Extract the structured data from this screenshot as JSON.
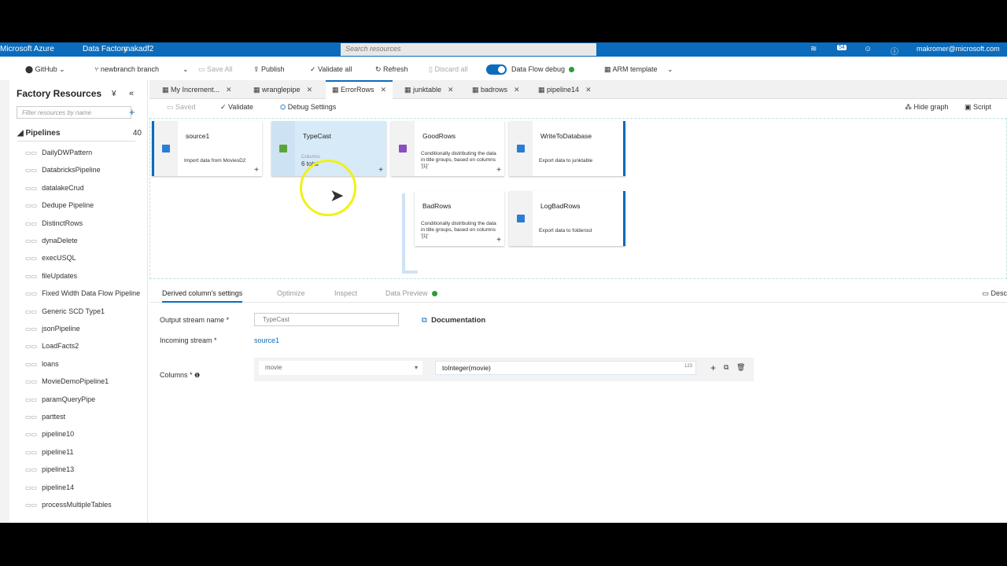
{
  "header": {
    "brand": "Microsoft Azure",
    "service": "Data Factory",
    "factory": "makadf2",
    "search_placeholder": "Search resources",
    "notifications": "54",
    "user": "makromer@microsoft.com"
  },
  "toolbar": {
    "github": "GitHub",
    "branch": "newbranch branch",
    "save_all": "Save All",
    "publish": "Publish",
    "validate_all": "Validate all",
    "refresh": "Refresh",
    "discard_all": "Discard all",
    "debug": "Data Flow debug",
    "arm": "ARM template"
  },
  "sidebar": {
    "title": "Factory Resources",
    "filter_placeholder": "Filter resources by name",
    "section": "Pipelines",
    "count": "40",
    "items": [
      "DailyDWPattern",
      "DatabricksPipeline",
      "datalakeCrud",
      "Dedupe Pipeline",
      "DistinctRows",
      "dynaDelete",
      "execUSQL",
      "fileUpdates",
      "Fixed Width Data Flow Pipeline",
      "Generic SCD Type1",
      "jsonPipeline",
      "LoadFacts2",
      "loans",
      "MovieDemoPipeline1",
      "paramQueryPipe",
      "parttest",
      "pipeline10",
      "pipeline11",
      "pipeline13",
      "pipeline14",
      "processMultipleTables"
    ]
  },
  "tabs": [
    "My Increment...",
    "wranglepipe",
    "ErrorRows",
    "junktable",
    "badrows",
    "pipeline14"
  ],
  "subbar": {
    "saved": "Saved",
    "validate": "Validate",
    "debug_settings": "Debug Settings",
    "hide_graph": "Hide graph",
    "script": "Script"
  },
  "nodes": [
    {
      "name": "source1",
      "desc": "Import data from MoviesD2"
    },
    {
      "name": "TypeCast",
      "label": "Columns",
      "desc": "6 total"
    },
    {
      "name": "GoodRows",
      "desc": "Conditionally distributing the data in title groups, based on columns '[1]'"
    },
    {
      "name": "WriteToDatabase",
      "desc": "Export data to junktable"
    },
    {
      "name": "BadRows",
      "desc": "Conditionally distributing the data in title groups, based on columns '[1]'"
    },
    {
      "name": "LogBadRows",
      "desc": "Export data to folderout"
    }
  ],
  "settings": {
    "tabs": [
      "Derived column's settings",
      "Optimize",
      "Inspect",
      "Data Preview"
    ],
    "desc": "Desc",
    "output_label": "Output stream name *",
    "output_value": "TypeCast",
    "documentation": "Documentation",
    "incoming_label": "Incoming stream *",
    "incoming_value": "source1",
    "columns_label": "Columns *",
    "column_name": "movie",
    "expression": "toInteger(movie)",
    "type_badge": "123"
  },
  "colors": {
    "accent": "#0b6cbd",
    "status_ok": "#2a9d3a"
  }
}
